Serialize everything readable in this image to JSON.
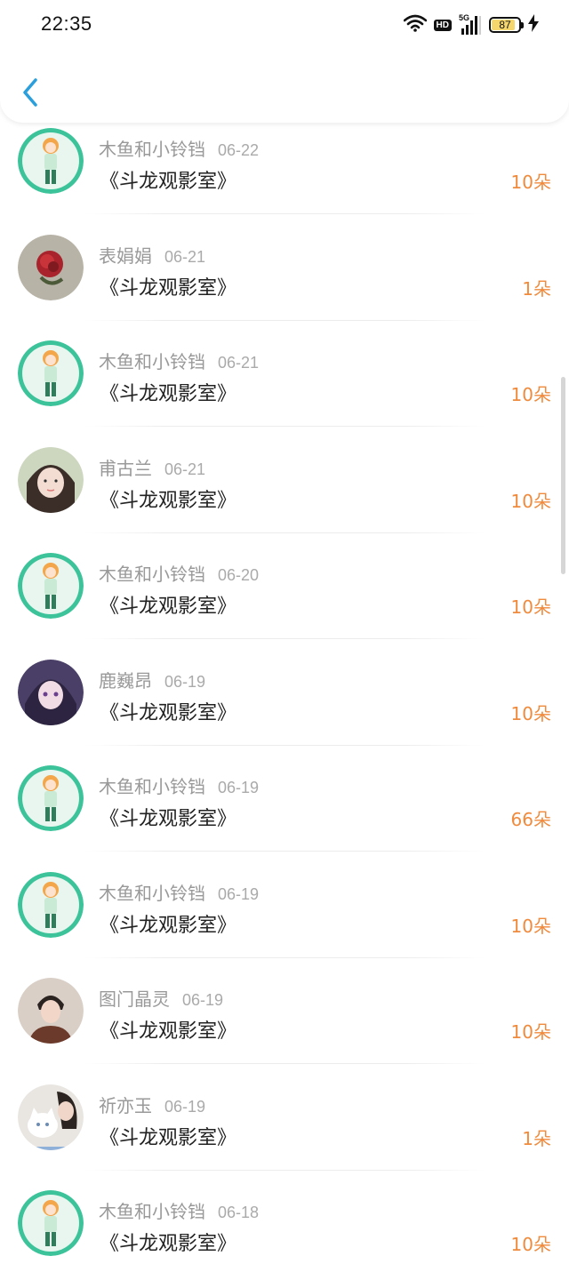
{
  "status_bar": {
    "time": "22:35",
    "hd": "HD",
    "network": "5G",
    "battery": "87",
    "icons": [
      "wifi-icon",
      "hd-icon",
      "signal-5g-icon",
      "battery-icon",
      "charging-bolt-icon"
    ]
  },
  "nav": {
    "back_icon": "chevron-left-icon",
    "accent_color": "#2b9fdc"
  },
  "colors": {
    "amount": "#f08a3c",
    "name": "#999999",
    "title": "#222222",
    "avatar_ring": "#3cc39a"
  },
  "items": [
    {
      "name": "木鱼和小铃铛",
      "date": "06-22",
      "title": "《斗龙观影室》",
      "amount": "10朵",
      "avatar": "anime-girl-avatar"
    },
    {
      "name": "表娟娟",
      "date": "06-21",
      "title": "《斗龙观影室》",
      "amount": "1朵",
      "avatar": "red-rose-avatar"
    },
    {
      "name": "木鱼和小铃铛",
      "date": "06-21",
      "title": "《斗龙观影室》",
      "amount": "10朵",
      "avatar": "anime-girl-avatar"
    },
    {
      "name": "甫古兰",
      "date": "06-21",
      "title": "《斗龙观影室》",
      "amount": "10朵",
      "avatar": "girl-photo-avatar"
    },
    {
      "name": "木鱼和小铃铛",
      "date": "06-20",
      "title": "《斗龙观影室》",
      "amount": "10朵",
      "avatar": "anime-girl-avatar"
    },
    {
      "name": "鹿巍昂",
      "date": "06-19",
      "title": "《斗龙观影室》",
      "amount": "10朵",
      "avatar": "purple-anime-avatar"
    },
    {
      "name": "木鱼和小铃铛",
      "date": "06-19",
      "title": "《斗龙观影室》",
      "amount": "66朵",
      "avatar": "anime-girl-avatar"
    },
    {
      "name": "木鱼和小铃铛",
      "date": "06-19",
      "title": "《斗龙观影室》",
      "amount": "10朵",
      "avatar": "anime-girl-avatar"
    },
    {
      "name": "图门晶灵",
      "date": "06-19",
      "title": "《斗龙观影室》",
      "amount": "10朵",
      "avatar": "man-photo-avatar"
    },
    {
      "name": "祈亦玉",
      "date": "06-19",
      "title": "《斗龙观影室》",
      "amount": "1朵",
      "avatar": "cat-photo-avatar"
    },
    {
      "name": "木鱼和小铃铛",
      "date": "06-18",
      "title": "《斗龙观影室》",
      "amount": "10朵",
      "avatar": "anime-girl-avatar"
    }
  ]
}
